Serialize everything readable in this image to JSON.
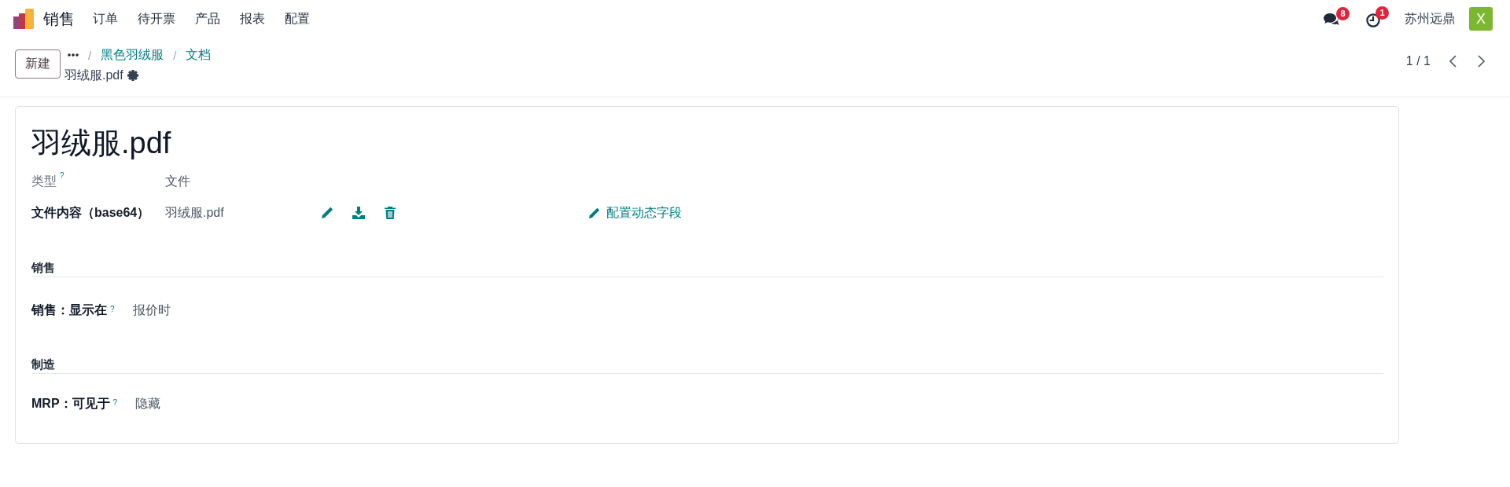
{
  "navbar": {
    "app_name": "销售",
    "menu": [
      "订单",
      "待开票",
      "产品",
      "报表",
      "配置"
    ],
    "systray": [
      {
        "kind": "messages",
        "badge": "8"
      },
      {
        "kind": "activities",
        "badge": "1"
      }
    ],
    "company": "苏州远鼎",
    "avatar_letter": "X"
  },
  "control_panel": {
    "new_button": "新建",
    "breadcrumbs": [
      {
        "separator": "/",
        "label": "黑色羽绒服"
      },
      {
        "separator": "/",
        "label": "文档"
      }
    ],
    "current_record": "羽绒服.pdf",
    "pager": "1 / 1"
  },
  "form": {
    "title": "羽绒服.pdf",
    "fields": [
      {
        "kind": "readonly",
        "label": "类型",
        "help": "?",
        "value": "文件"
      },
      {
        "kind": "binary",
        "label": "文件内容（base64）",
        "value": "羽绒服.pdf"
      }
    ],
    "dynamic_fields_link": "配置动态字段",
    "sections": [
      {
        "title": "销售",
        "fields": [
          {
            "label": "销售：显示在",
            "help": "?",
            "value": "报价时"
          }
        ]
      },
      {
        "title": "制造",
        "fields": [
          {
            "label": "MRP：可见于",
            "help": "?",
            "value": "隐藏"
          }
        ]
      }
    ]
  }
}
